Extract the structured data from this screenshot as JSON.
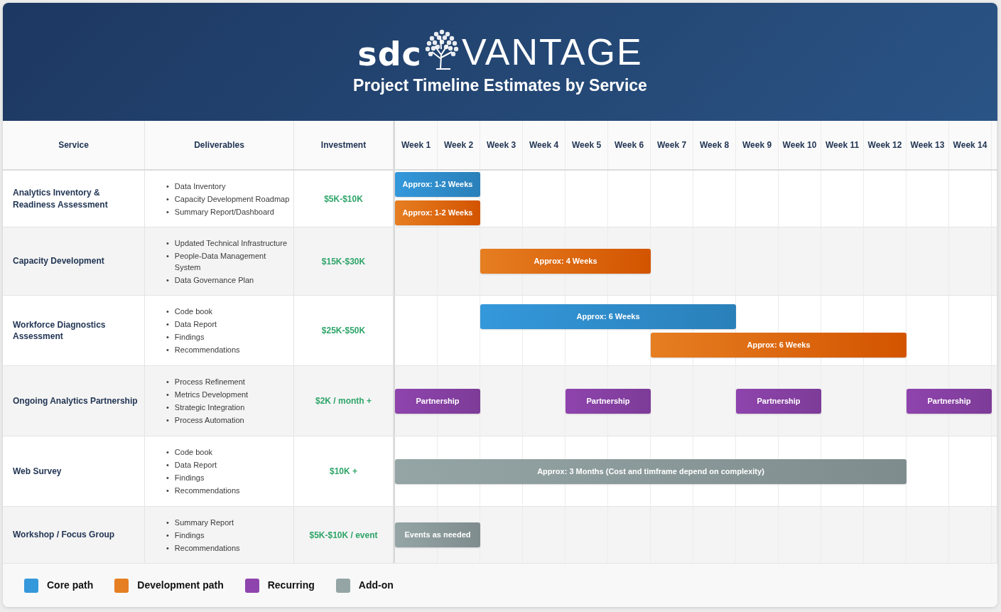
{
  "header": {
    "logo_brand": "sdc",
    "logo_name": "VANTAGE",
    "title": "Project Timeline Estimates by Service"
  },
  "columns": [
    "Service",
    "Deliverables",
    "Investment"
  ],
  "weeks": [
    "Week 1",
    "Week 2",
    "Week 3",
    "Week 4",
    "Week 5",
    "Week 6",
    "Week 7",
    "Week 8",
    "Week 9",
    "Week 10",
    "Week 11",
    "Week 12",
    "Week 13",
    "Week 14"
  ],
  "rows": [
    {
      "service": "Analytics Inventory & Readiness Assessment",
      "deliverables": [
        {
          "marker": "•",
          "text": "Data Inventory"
        },
        {
          "marker": "•",
          "text": "Capacity Development Roadmap"
        },
        {
          "marker": "•",
          "text": "Summary Report/Dashboard"
        }
      ],
      "investment": "$5K-$10K",
      "lanes": [
        [
          {
            "label": "Approx: 1-2 Weeks",
            "kind": "core"
          }
        ],
        [
          {
            "label": "Approx: 1-2 Weeks",
            "kind": "development"
          }
        ]
      ]
    },
    {
      "service": "Capacity Development",
      "deliverables": [
        {
          "marker": "•",
          "text": "Updated Technical Infrastructure"
        },
        {
          "marker": "•",
          "text": "People-Data Management System"
        },
        {
          "marker": "•",
          "text": "Data Governance Plan"
        }
      ],
      "investment": "$15K-$30K",
      "lanes": [
        [
          {
            "label": "Approx: 4 Weeks",
            "kind": "development"
          }
        ]
      ]
    },
    {
      "service": "Workforce Diagnostics Assessment",
      "deliverables": [
        {
          "marker": "•",
          "text": "Code book"
        },
        {
          "marker": "•",
          "text": "Data Report"
        },
        {
          "marker": "•",
          "text": "Findings"
        },
        {
          "marker": "•",
          "text": "Recommendations"
        }
      ],
      "investment": "$25K-$50K",
      "lanes": [
        [
          {
            "label": "Approx: 6 Weeks",
            "kind": "core"
          }
        ],
        [
          {
            "label": "Approx: 6 Weeks",
            "kind": "development"
          }
        ]
      ]
    },
    {
      "service": "Ongoing Analytics Partnership",
      "deliverables": [
        {
          "marker": "•",
          "text": "Process Refinement"
        },
        {
          "marker": "•",
          "text": "Metrics Development"
        },
        {
          "marker": "•",
          "text": "Strategic Integration"
        },
        {
          "marker": "•",
          "text": "Process Automation"
        }
      ],
      "investment": "$2K / month +",
      "lanes": [
        [
          {
            "label": "Partnership",
            "kind": "recurring"
          },
          {
            "label": "Partnership",
            "kind": "recurring"
          },
          {
            "label": "Partnership",
            "kind": "recurring"
          },
          {
            "label": "Partnership",
            "kind": "recurring"
          }
        ]
      ]
    },
    {
      "service": "Web Survey",
      "deliverables": [
        {
          "marker": "•",
          "text": "Code book"
        },
        {
          "marker": "•",
          "text": "Data Report"
        },
        {
          "marker": "•",
          "text": "Findings"
        },
        {
          "marker": "•",
          "text": "Recommendations"
        }
      ],
      "investment": "$10K +",
      "lanes": [
        [
          {
            "label": "Approx: 3 Months (Cost and timframe depend on complexity)",
            "kind": "addon"
          }
        ]
      ]
    },
    {
      "service": "Workshop / Focus Group",
      "deliverables": [
        {
          "marker": "•",
          "text": "Summary Report"
        },
        {
          "marker": "•",
          "text": "Findings"
        },
        {
          "marker": "•",
          "text": "Recommendations"
        }
      ],
      "investment": "$5K-$10K / event",
      "lanes": [
        [
          {
            "label": "Events as needed",
            "kind": "addon"
          }
        ]
      ]
    }
  ],
  "legend": [
    {
      "label": "Core path",
      "color": "#3498db"
    },
    {
      "label": "Development path",
      "color": "#e67e22"
    },
    {
      "label": "Recurring",
      "color": "#8e44ad"
    },
    {
      "label": "Add-on",
      "color": "#95a5a6"
    }
  ]
}
